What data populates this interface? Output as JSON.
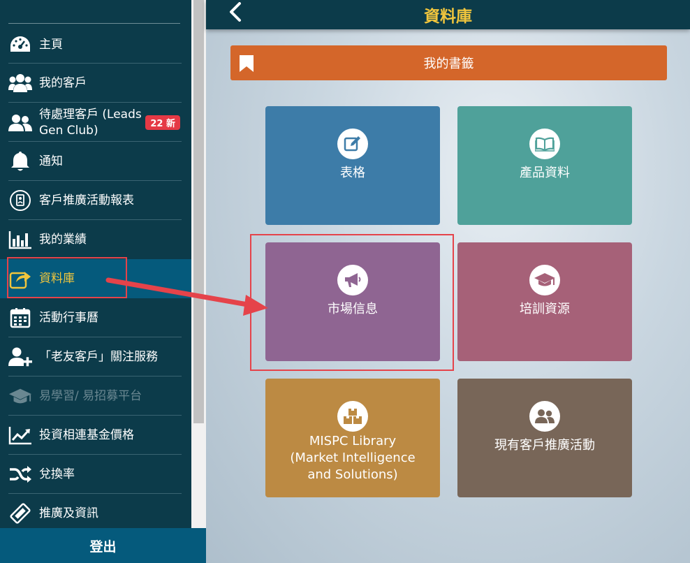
{
  "sidebar": {
    "items": [
      {
        "label": "主頁",
        "icon": "dashboard-icon"
      },
      {
        "label": "我的客戶",
        "icon": "users-icon"
      },
      {
        "label": "待處理客戶 (Leads Gen Club)",
        "label_line1": "待處理客戶 (Leads",
        "label_line2": "Gen Club)",
        "icon": "user-group-icon",
        "badge": "22 新"
      },
      {
        "label": "通知",
        "icon": "bell-icon"
      },
      {
        "label": "客戶推廣活動報表",
        "icon": "report-icon"
      },
      {
        "label": "我的業績",
        "icon": "bar-chart-icon"
      },
      {
        "label": "資料庫",
        "icon": "share-icon",
        "active": true
      },
      {
        "label": "活動行事曆",
        "icon": "calendar-icon"
      },
      {
        "label": "「老友客戶」關注服務",
        "icon": "add-user-icon"
      },
      {
        "label": "易學習/ 易招募平台",
        "icon": "graduation-cap-icon",
        "disabled": true
      },
      {
        "label": "投資相連基金價格",
        "icon": "line-chart-icon"
      },
      {
        "label": "兌換率",
        "icon": "shuffle-icon"
      },
      {
        "label": "推廣及資訊",
        "icon": "ticket-icon"
      }
    ],
    "logout_label": "登出"
  },
  "header": {
    "title": "資料庫"
  },
  "bookmark": {
    "label": "我的書籤"
  },
  "tiles": [
    {
      "label": "表格",
      "icon": "edit-icon",
      "color": "#3d7ca8"
    },
    {
      "label": "產品資料",
      "icon": "book-icon",
      "color": "#4fa19a"
    },
    {
      "label": "市場信息",
      "icon": "megaphone-icon",
      "color": "#8f6592"
    },
    {
      "label": "培訓資源",
      "icon": "graduation-cap-icon",
      "color": "#a66178"
    },
    {
      "label_line1": "MISPC Library",
      "label_line2": "(Market Intelligence",
      "label_line3": "and Solutions)",
      "icon": "boxes-icon",
      "color": "#bc8a43"
    },
    {
      "label": "現有客戶推廣活動",
      "icon": "users-icon",
      "color": "#786658"
    }
  ],
  "colors": {
    "sidebar_bg": "#0c3b4a",
    "active_bg": "#055a7c",
    "accent_yellow": "#f0c53d",
    "bookmark_orange": "#d4662a",
    "badge_red": "#e53945",
    "annotation_red": "#e5434a"
  }
}
